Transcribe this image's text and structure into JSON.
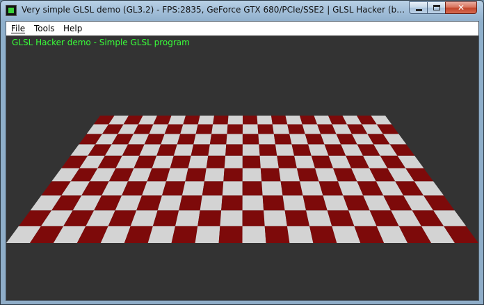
{
  "window": {
    "title": "Very simple GLSL demo (GL3.2) - FPS:2835, GeForce GTX 680/PCIe/SSE2 | GLSL Hacker (beta) (Windows...",
    "icon": "app-icon",
    "controls": {
      "minimize": "minimize-icon",
      "maximize": "maximize-icon",
      "close_label": "✕"
    }
  },
  "menu": {
    "items": [
      {
        "label": "File"
      },
      {
        "label": "Tools"
      },
      {
        "label": "Help"
      }
    ]
  },
  "viewport": {
    "overlay_text": "GLSL Hacker demo - Simple GLSL program",
    "background": "#333333",
    "overlay_color": "#39ff39",
    "checker_colors": [
      "#7d0a0a",
      "#d3d3d3"
    ]
  }
}
